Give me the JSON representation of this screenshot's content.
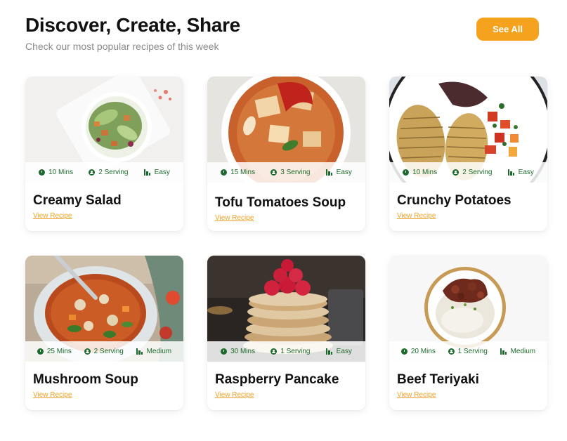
{
  "header": {
    "title": "Discover, Create, Share",
    "subtitle": "Check our most popular recipes of this week",
    "see_all_label": "See All"
  },
  "colors": {
    "accent": "#f5a21f",
    "meta_green": "#1d6b2c",
    "link": "#f0a128"
  },
  "recipes": [
    {
      "name": "Creamy Salad",
      "time": "10 Mins",
      "serving": "2 Serving",
      "level": "Easy",
      "link": "View Recipe"
    },
    {
      "name": "Tofu Tomatoes Soup",
      "time": "15 Mins",
      "serving": "3 Serving",
      "level": "Easy",
      "link": "View Recipe"
    },
    {
      "name": "Crunchy Potatoes",
      "time": "10 Mins",
      "serving": "2 Serving",
      "level": "Easy",
      "link": "View Recipe"
    },
    {
      "name": "Mushroom Soup",
      "time": "25 Mins",
      "serving": "2 Serving",
      "level": "Medium",
      "link": "View Recipe"
    },
    {
      "name": "Raspberry Pancake",
      "time": "30 Mins",
      "serving": "1 Serving",
      "level": "Easy",
      "link": "View Recipe"
    },
    {
      "name": "Beef Teriyaki",
      "time": "20 Mins",
      "serving": "1 Serving",
      "level": "Medium",
      "link": "View Recipe"
    }
  ]
}
